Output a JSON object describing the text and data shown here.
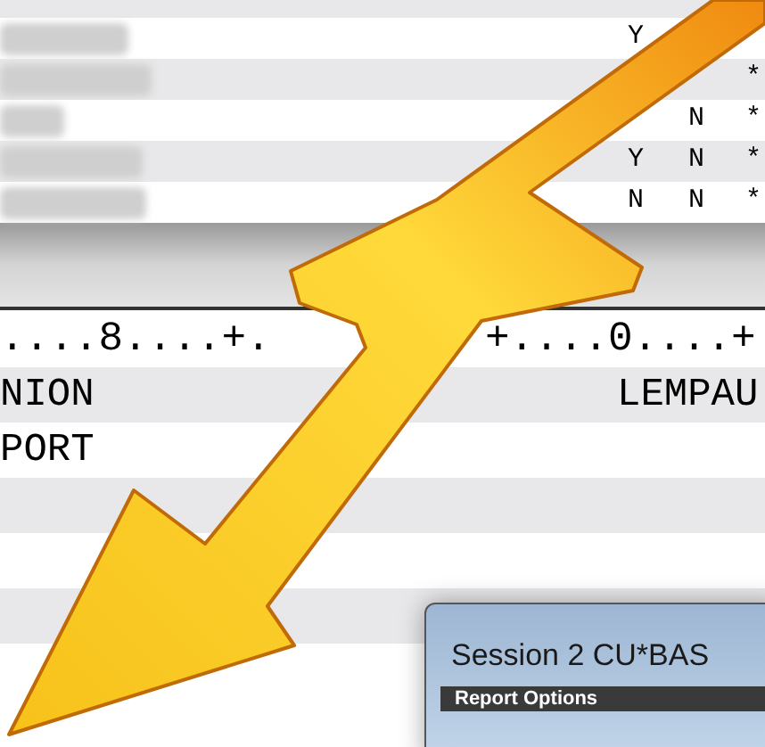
{
  "top_rows": [
    {
      "col_1": "Y"
    },
    {
      "col_3": "*"
    },
    {
      "col_2": "N",
      "col_3": "*"
    },
    {
      "col_1": "Y",
      "col_2": "N",
      "col_3": "*"
    },
    {
      "col_1": "N",
      "col_2": "N",
      "col_3": "*"
    }
  ],
  "ruler": [
    "....8....+.",
    "+....0....+"
  ],
  "lines": [
    {
      "left": "NION",
      "right": "LEMPAU"
    },
    {
      "left": "PORT"
    }
  ],
  "dialog": {
    "title": "Session 2 CU*BAS",
    "header": "Report Options"
  }
}
